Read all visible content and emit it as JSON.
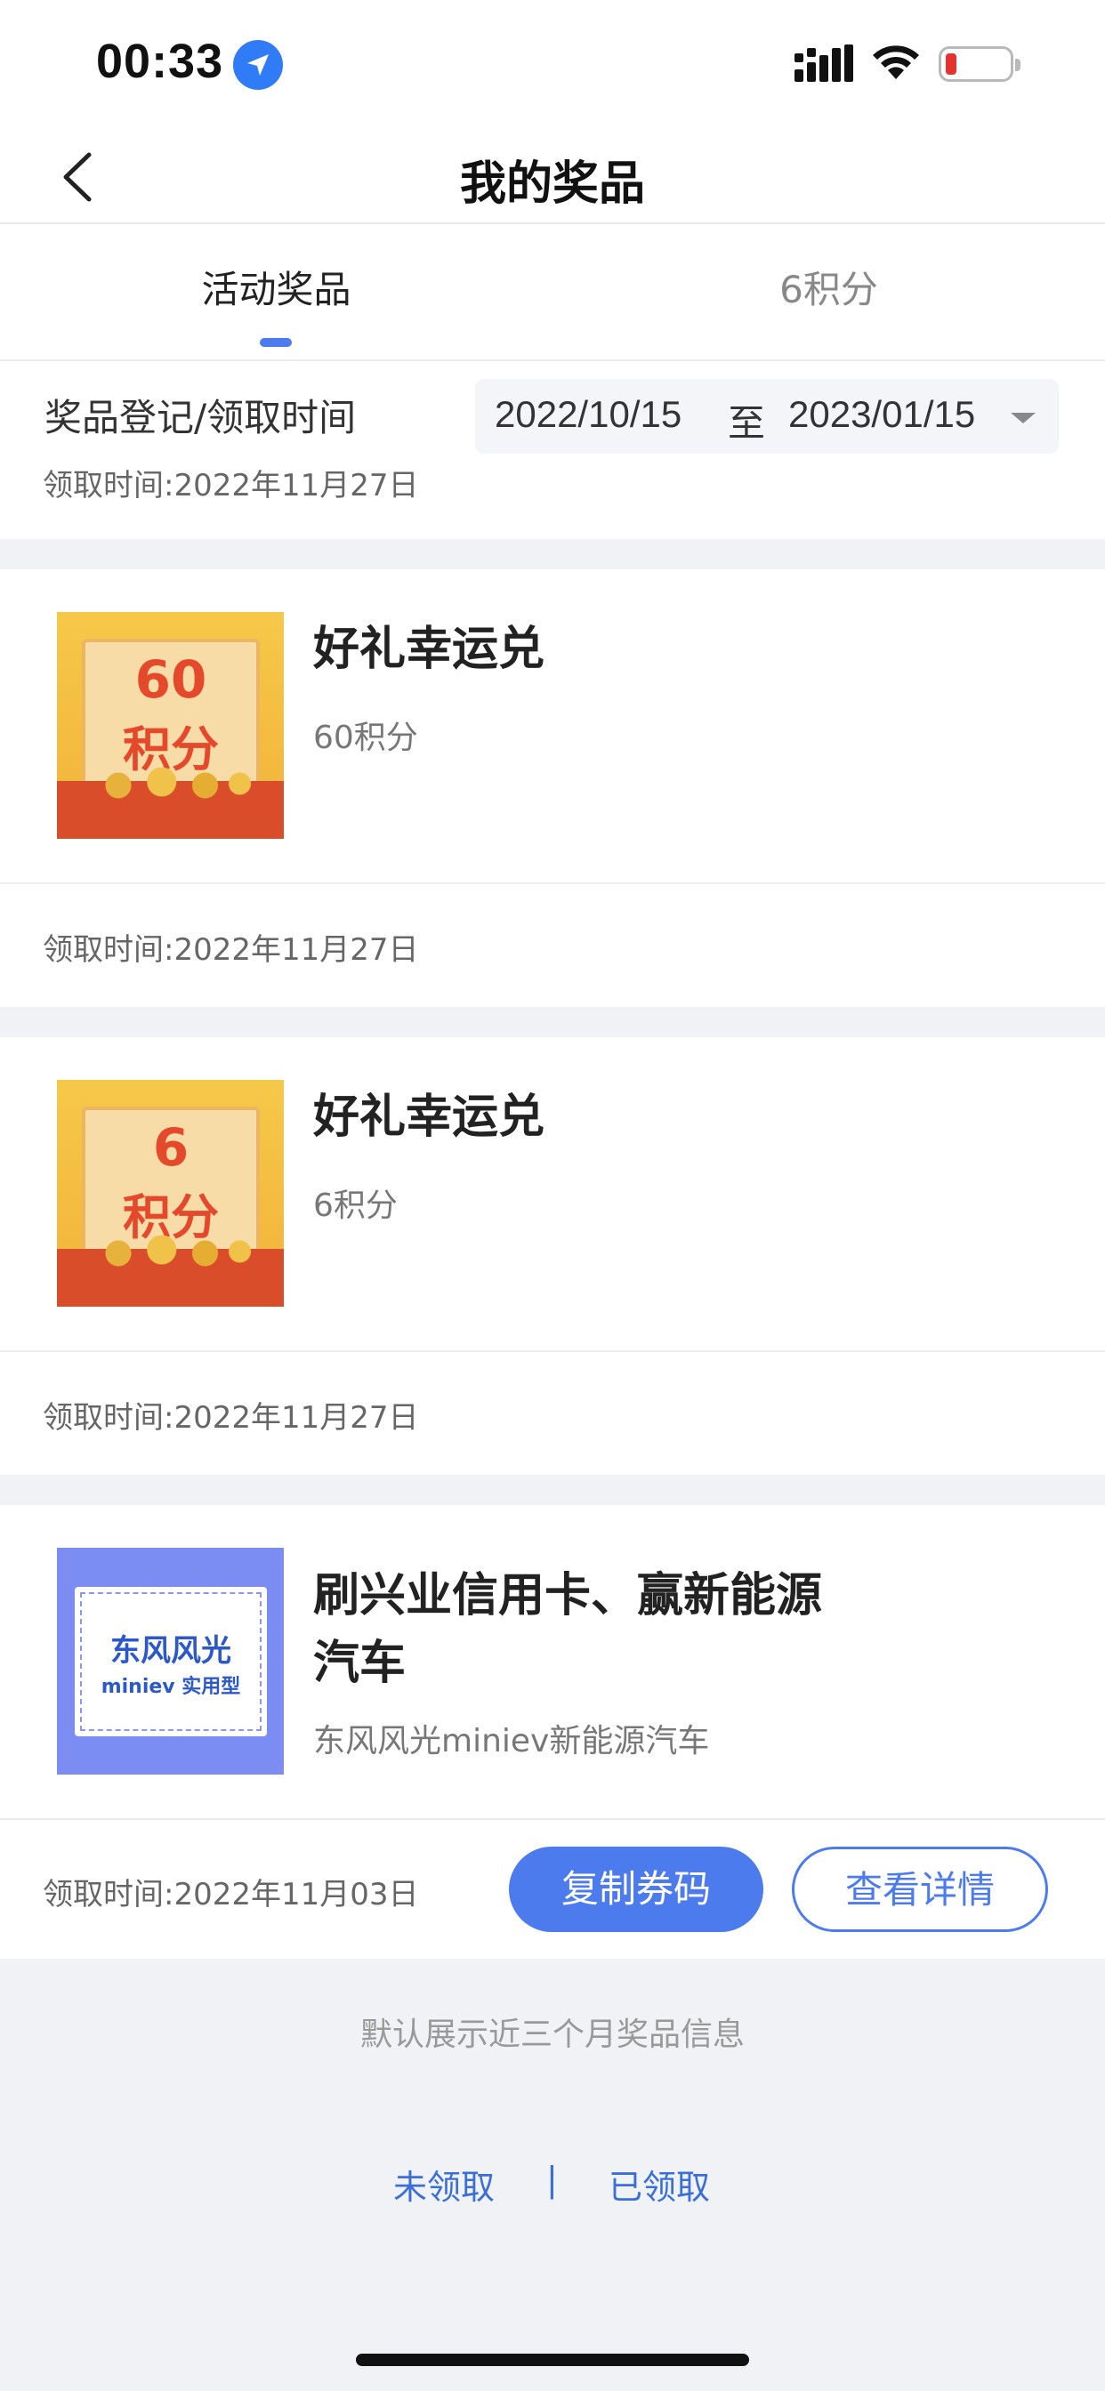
{
  "status_bar": {
    "time": "00:33",
    "icons": [
      "location-arrow-icon",
      "signal-icon",
      "wifi-icon",
      "battery-low-icon"
    ],
    "battery_color": "#e6322e"
  },
  "nav": {
    "title": "我的奖品",
    "back_icon": "chevron-left-icon"
  },
  "tabs": [
    {
      "label": "活动奖品",
      "active": true
    },
    {
      "label": "6积分",
      "active": false
    }
  ],
  "filter": {
    "label": "奖品登记/领取时间",
    "start_date": "2022/10/15",
    "separator": "至",
    "end_date": "2023/01/15"
  },
  "partial_card": {
    "time_text": "领取时间:2022年11月27日"
  },
  "cards": [
    {
      "thumb_line1": "60",
      "thumb_line2": "积分",
      "title": "好礼幸运兑",
      "subtitle": "60积分",
      "time_text": "领取时间:2022年11月27日"
    },
    {
      "thumb_line1": "6",
      "thumb_line2": "积分",
      "title": "好礼幸运兑",
      "subtitle": "6积分",
      "time_text": "领取时间:2022年11月27日"
    },
    {
      "thumb_line1": "东风风光",
      "thumb_line2": "miniev 实用型",
      "title_line1": "刷兴业信用卡、赢新能源",
      "title_line2": "汽车",
      "subtitle": "东风风光miniev新能源汽车",
      "time_text": "领取时间:2022年11月03日",
      "copy_button": "复制券码",
      "detail_button": "查看详情"
    }
  ],
  "footer": {
    "note": "默认展示近三个月奖品信息",
    "link_unclaimed": "未领取",
    "divider": "|",
    "link_claimed": "已领取"
  },
  "colors": {
    "accent": "#4b7bec",
    "background": "#f1f2f6"
  }
}
